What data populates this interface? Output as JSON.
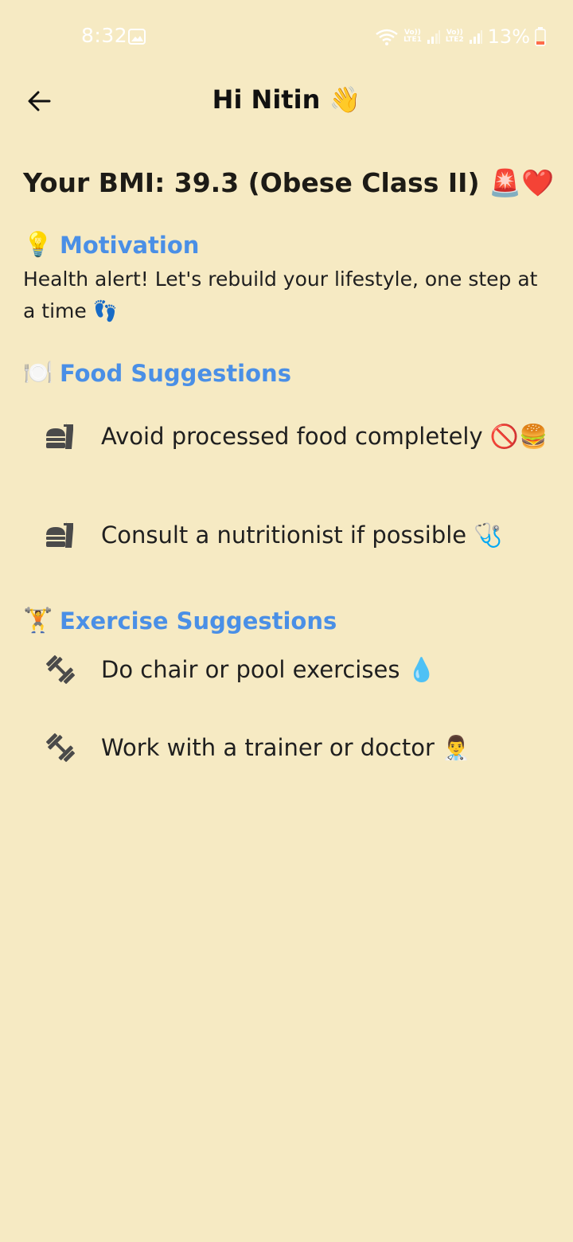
{
  "status_bar": {
    "time": "8:32",
    "net1_top": "Vo))",
    "net1_bottom": "LTE1",
    "net2_top": "Vo))",
    "net2_bottom": "LTE2",
    "battery": "13%"
  },
  "app_bar": {
    "title": "Hi Nitin 👋"
  },
  "bmi": {
    "heading": "Your BMI: 39.3 (Obese Class II) 🚨❤️"
  },
  "motivation": {
    "emoji": "💡",
    "title": "Motivation",
    "text": "Health alert! Let's rebuild your lifestyle, one step at a time 👣"
  },
  "food": {
    "emoji": "🍽️",
    "title": "Food Suggestions",
    "items": [
      "Avoid processed food completely 🚫🍔",
      "Consult a nutritionist if possible 🩺"
    ]
  },
  "exercise": {
    "emoji": "🏋️",
    "title": "Exercise Suggestions",
    "items": [
      "Do chair or pool exercises 💧",
      "Work with a trainer or doctor 👨‍⚕️"
    ]
  },
  "colors": {
    "background": "#f6eac3",
    "section_title": "#4a8fe6",
    "icon": "#4a4a4a"
  },
  "icons": {
    "back": "arrow-left-icon",
    "food_item": "fastfood-icon",
    "exercise_item": "dumbbell-icon"
  }
}
